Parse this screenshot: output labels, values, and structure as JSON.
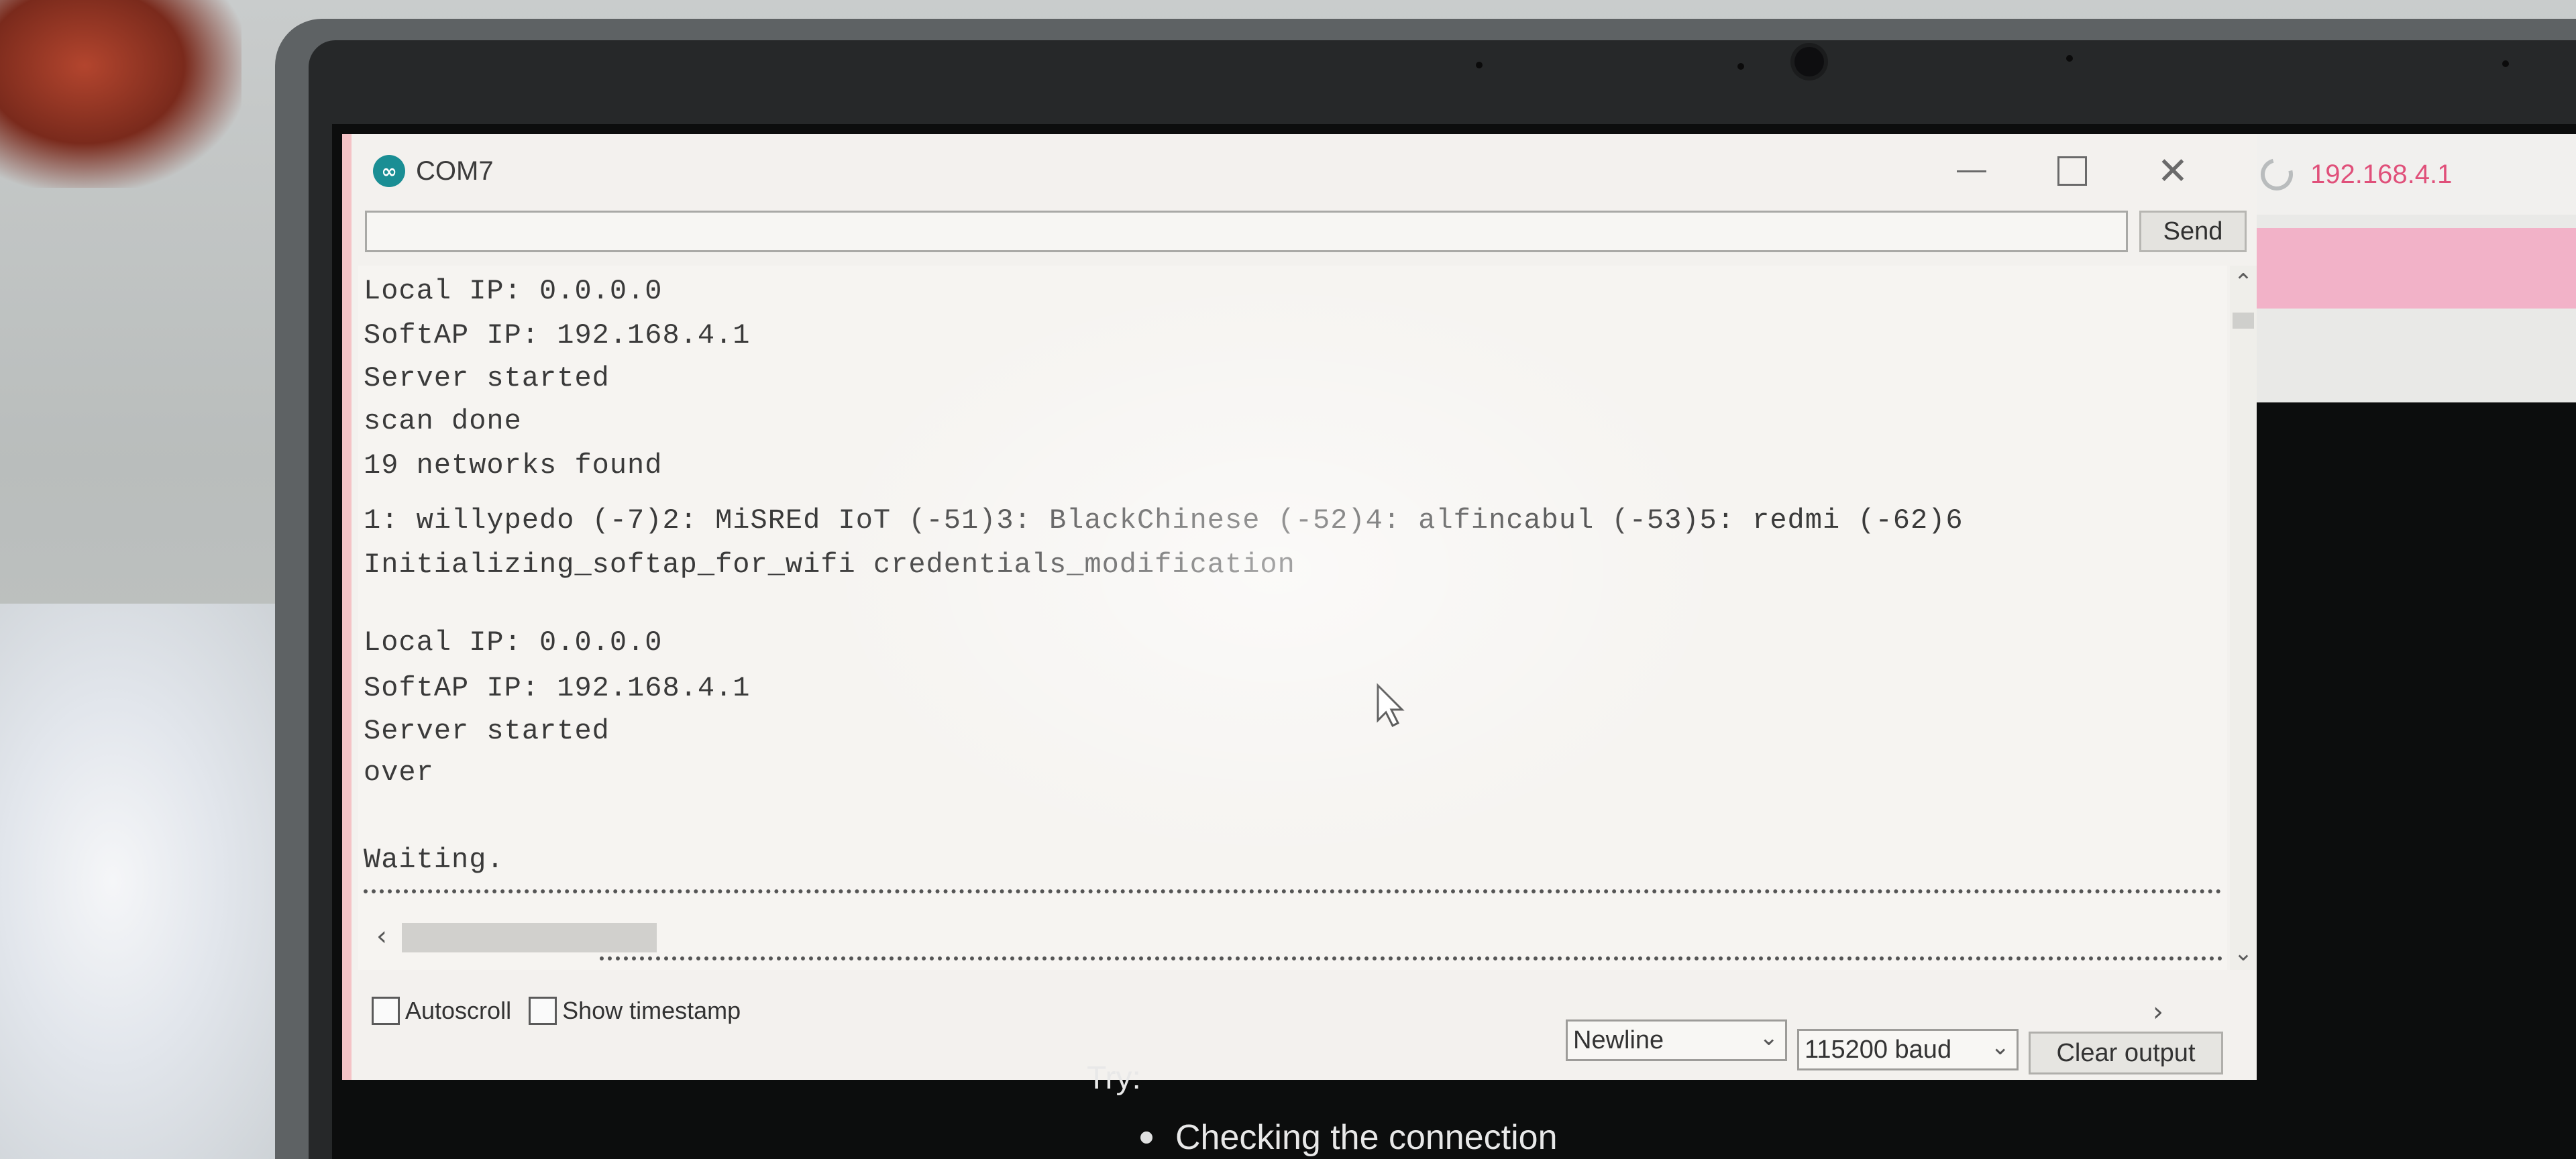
{
  "window": {
    "title": "COM7",
    "app_icon": "arduino-infinity-icon"
  },
  "browser_tab": {
    "title": "192.168.4.1"
  },
  "send_bar": {
    "input_value": "",
    "send_label": "Send"
  },
  "serial_output": {
    "lines": [
      "Local IP: 0.0.0.0",
      "SoftAP IP: 192.168.4.1",
      "Server started",
      "scan done",
      "19 networks found",
      "1: willypedo (-7)2: MiSREd IoT (-51)3: BlackChinese (-52)4: alfincabul (-53)5: redmi (-62)6",
      "Initializing_softap_for_wifi credentials_modification",
      "",
      "Local IP: 0.0.0.0",
      "SoftAP IP: 192.168.4.1",
      "Server started",
      "over",
      "",
      "Waiting."
    ]
  },
  "footer": {
    "autoscroll_label": "Autoscroll",
    "timestamp_label": "Show timestamp",
    "line_ending": "Newline",
    "baud_rate": "115200 baud",
    "clear_label": "Clear output"
  },
  "below_window": {
    "try_label": "Try:",
    "bullet_1": "Checking the connection"
  },
  "colors": {
    "browser_tab_title": "#e0507a",
    "window_accent": "#f4c3c6",
    "arduino_teal": "#1a8e94"
  }
}
